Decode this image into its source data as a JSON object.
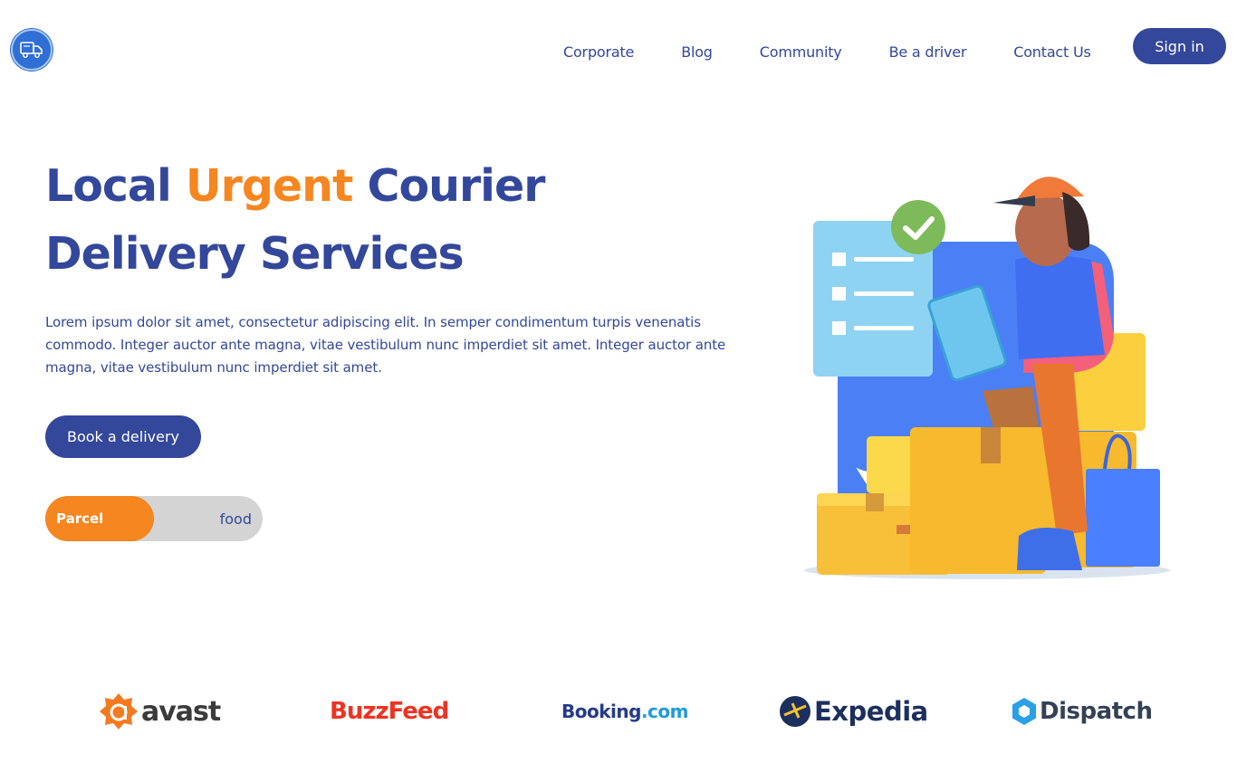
{
  "nav": {
    "items": [
      "Corporate",
      "Blog",
      "Community",
      "Be a driver",
      "Contact Us"
    ],
    "signin_label": "Sign in"
  },
  "hero": {
    "title_part1": "Local ",
    "title_accent": "Urgent",
    "title_part2": " Courier",
    "title_line2": "Delivery Services",
    "description": "Lorem ipsum dolor sit amet, consectetur adipiscing elit. In semper condimentum turpis venenatis commodo. Integer auctor ante magna, vitae vestibulum nunc imperdiet sit amet. Integer auctor ante magna, vitae vestibulum nunc imperdiet sit amet.",
    "cta_label": "Book a delivery"
  },
  "toggle": {
    "active_label": "Parcel",
    "inactive_label": "food"
  },
  "brands": {
    "avast": "avast",
    "buzzfeed": "BuzzFeed",
    "booking_main": "Booking",
    "booking_suffix": ".com",
    "expedia": "Expedia",
    "dispatch": "Dispatch"
  },
  "colors": {
    "primary": "#33479b",
    "accent": "#f6861f",
    "toggle_bg": "#d4d4d4"
  },
  "icons": {
    "logo": "delivery-truck-icon"
  }
}
